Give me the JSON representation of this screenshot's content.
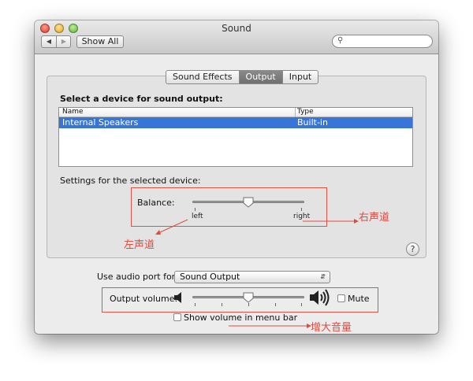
{
  "window": {
    "title": "Sound"
  },
  "toolbar": {
    "back_glyph": "◀",
    "forward_glyph": "▶",
    "show_all_label": "Show All",
    "search_placeholder": ""
  },
  "tabs": [
    {
      "label": "Sound Effects",
      "selected": false
    },
    {
      "label": "Output",
      "selected": true
    },
    {
      "label": "Input",
      "selected": false
    }
  ],
  "output": {
    "select_heading": "Select a device for sound output:",
    "columns": [
      "Name",
      "Type"
    ],
    "rows": [
      {
        "name": "Internal Speakers",
        "type": "Built-in",
        "selected": true
      }
    ],
    "settings_heading": "Settings for the selected device:",
    "balance_label": "Balance:",
    "balance_left": "left",
    "balance_right": "right",
    "balance_value": 0.5
  },
  "bottom": {
    "audio_port_label": "Use audio port for:",
    "audio_port_value": "Sound Output",
    "output_volume_label": "Output volume:",
    "volume_value": 0.5,
    "mute_label": "Mute",
    "mute_checked": false,
    "show_volume_label": "Show volume in menu bar",
    "show_volume_checked": false
  },
  "annotations": {
    "right_channel": "右声道",
    "left_channel": "左声道",
    "increase_volume": "增大音量",
    "color": "#e04b40"
  },
  "help_glyph": "?",
  "colors": {
    "selection": "#3875d7",
    "annotation": "#e04b40"
  }
}
